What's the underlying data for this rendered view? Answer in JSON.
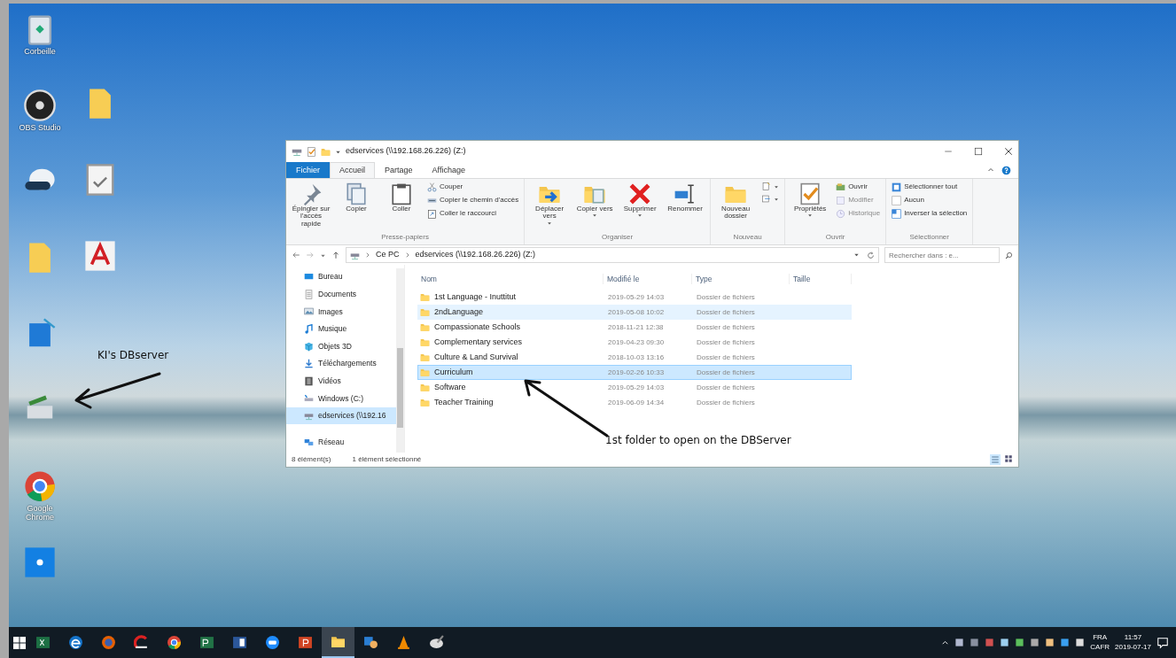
{
  "desktop": {
    "columns": [
      [
        {
          "kind": "bin",
          "label": "Corbeille"
        },
        {
          "kind": "obs",
          "label": "OBS Studio"
        },
        {
          "kind": "headset"
        },
        {
          "kind": "folder"
        },
        {
          "kind": "app"
        },
        {
          "kind": "server"
        },
        {
          "kind": "chrome",
          "label": "Google Chrome"
        },
        {
          "kind": "tile"
        }
      ],
      [
        {
          "kind": "folder"
        },
        {
          "kind": "doc"
        },
        {
          "kind": "pdf"
        }
      ]
    ]
  },
  "explorer": {
    "title": "edservices (\\\\192.168.26.226) (Z:)",
    "ribbon_tabs": [
      {
        "label": "Fichier",
        "kind": "file",
        "selected": false
      },
      {
        "label": "Accueil",
        "kind": "tab",
        "selected": true
      },
      {
        "label": "Partage",
        "kind": "tab",
        "selected": false
      },
      {
        "label": "Affichage",
        "kind": "tab",
        "selected": false
      }
    ],
    "ribbon_groups": [
      {
        "label": "Presse-papiers",
        "large": [
          {
            "kind": "pin",
            "label": "Épingler sur l'accès rapide"
          },
          {
            "kind": "copy",
            "label": "Copier"
          },
          {
            "kind": "paste",
            "label": "Coller"
          }
        ],
        "small": [
          {
            "kind": "cut",
            "label": "Couper"
          },
          {
            "kind": "path",
            "label": "Copier le chemin d'accès"
          },
          {
            "kind": "shortcut",
            "label": "Coller le raccourci"
          }
        ]
      },
      {
        "label": "Organiser",
        "large": [
          {
            "kind": "move-to",
            "label": "Déplacer vers",
            "dropdown": true
          },
          {
            "kind": "copy-to",
            "label": "Copier vers",
            "dropdown": true
          },
          {
            "kind": "delete",
            "label": "Supprimer",
            "dropdown": true
          },
          {
            "kind": "rename",
            "label": "Renommer"
          }
        ]
      },
      {
        "label": "Nouveau",
        "large": [
          {
            "kind": "new-folder",
            "label": "Nouveau dossier"
          }
        ],
        "small": [
          {
            "kind": "new-item"
          },
          {
            "kind": "easy-access"
          }
        ]
      },
      {
        "label": "Ouvrir",
        "large": [
          {
            "kind": "properties",
            "label": "Propriétés",
            "dropdown": true
          }
        ],
        "small": [
          {
            "kind": "open",
            "label": "Ouvrir",
            "disabled": false
          },
          {
            "kind": "edit",
            "label": "Modifier",
            "disabled": true
          },
          {
            "kind": "history",
            "label": "Historique",
            "disabled": true
          }
        ]
      },
      {
        "label": "Sélectionner",
        "small": [
          {
            "kind": "select-all",
            "label": "Sélectionner tout"
          },
          {
            "kind": "select-none",
            "label": "Aucun"
          },
          {
            "kind": "invert",
            "label": "Inverser la sélection"
          }
        ]
      }
    ],
    "address": [
      "Ce PC",
      "edservices (\\\\192.168.26.226) (Z:)"
    ],
    "search": {
      "placeholder": "Rechercher dans : e..."
    },
    "nav": [
      {
        "kind": "desktop",
        "label": "Bureau",
        "selected": false
      },
      {
        "kind": "documents",
        "label": "Documents",
        "selected": false
      },
      {
        "kind": "images",
        "label": "Images",
        "selected": false
      },
      {
        "kind": "music",
        "label": "Musique",
        "selected": false
      },
      {
        "kind": "objects",
        "label": "Objets 3D",
        "selected": false
      },
      {
        "kind": "downloads",
        "label": "Téléchargements",
        "selected": false
      },
      {
        "kind": "videos",
        "label": "Vidéos",
        "selected": false
      },
      {
        "kind": "drive",
        "label": "Windows (C:)",
        "selected": false
      },
      {
        "kind": "netdrive",
        "label": "edservices (\\\\192.16",
        "selected": true
      },
      {
        "kind": "network",
        "label": "Réseau",
        "selected": false
      }
    ],
    "columns": [
      "Nom",
      "Modifié le",
      "Type",
      "Taille"
    ],
    "rows": [
      {
        "name": "1st Language - Inuttitut",
        "modified": "2019-05-29 14:03",
        "type": "Dossier de fichiers",
        "selected": false,
        "highlighted": false
      },
      {
        "name": "2ndLanguage",
        "modified": "2019-05-08 10:02",
        "type": "Dossier de fichiers",
        "selected": false,
        "highlighted": true
      },
      {
        "name": "Compassionate Schools",
        "modified": "2018-11-21 12:38",
        "type": "Dossier de fichiers",
        "selected": false,
        "highlighted": false
      },
      {
        "name": "Complementary services",
        "modified": "2019-04-23 09:30",
        "type": "Dossier de fichiers",
        "selected": false,
        "highlighted": false
      },
      {
        "name": "Culture & Land Survival",
        "modified": "2018-10-03 13:16",
        "type": "Dossier de fichiers",
        "selected": false,
        "highlighted": false
      },
      {
        "name": "Curriculum",
        "modified": "2019-02-26 10:33",
        "type": "Dossier de fichiers",
        "selected": true,
        "highlighted": false
      },
      {
        "name": "Software",
        "modified": "2019-05-29 14:03",
        "type": "Dossier de fichiers",
        "selected": false,
        "highlighted": false
      },
      {
        "name": "Teacher Training",
        "modified": "2019-06-09 14:34",
        "type": "Dossier de fichiers",
        "selected": false,
        "highlighted": false
      }
    ],
    "status": [
      "8 élément(s)",
      "1 élément sélectionné"
    ]
  },
  "annotations": [
    {
      "kind": "desktop",
      "text": "KI's DBserver"
    },
    {
      "kind": "window",
      "text": "1st folder to open on the DBServer"
    }
  ],
  "taskbar": {
    "apps": [
      {
        "kind": "sheet",
        "selected": false
      },
      {
        "kind": "edge",
        "selected": false
      },
      {
        "kind": "firefox",
        "selected": false
      },
      {
        "kind": "red-app",
        "selected": false
      },
      {
        "kind": "chrome",
        "selected": false
      },
      {
        "kind": "project",
        "selected": false
      },
      {
        "kind": "word",
        "selected": false
      },
      {
        "kind": "chat",
        "selected": false
      },
      {
        "kind": "slides",
        "selected": false
      },
      {
        "kind": "explorer",
        "selected": true
      },
      {
        "kind": "people",
        "selected": false
      },
      {
        "kind": "cone",
        "selected": false
      },
      {
        "kind": "paint",
        "selected": false
      }
    ],
    "tray": [
      "FRA",
      "CAFR"
    ],
    "clock": [
      "11:57",
      "2019-07-17"
    ]
  }
}
